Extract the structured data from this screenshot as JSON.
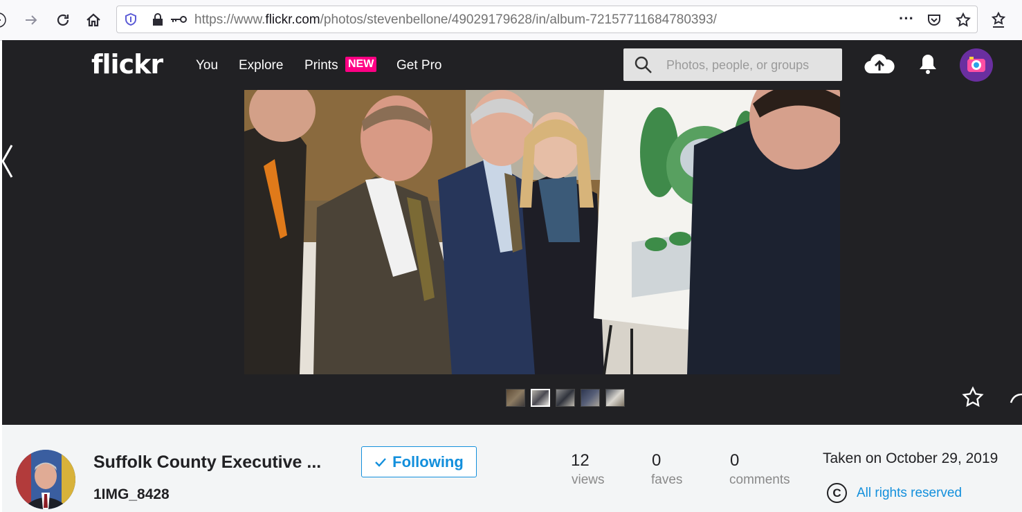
{
  "browser": {
    "url_prefix": "https://www.",
    "url_domain": "flickr.com",
    "url_path": "/photos/stevenbellone/49029179628/in/album-72157711684780393/",
    "icons": [
      "back-arrow-icon",
      "forward-arrow-icon",
      "reload-icon",
      "home-icon",
      "shield-icon",
      "lock-icon",
      "key-icon",
      "more-icon",
      "pocket-icon",
      "star-icon",
      "bookmarks-icon"
    ]
  },
  "header": {
    "logo": "flickr",
    "nav": {
      "you": "You",
      "explore": "Explore",
      "prints": "Prints",
      "prints_badge": "NEW",
      "get_pro": "Get Pro"
    },
    "search_placeholder": "Photos, people, or groups"
  },
  "photo": {
    "thumbnail_count": 5
  },
  "info": {
    "owner_name": "Suffolk County Executive ...",
    "photo_title": "1IMG_8428",
    "follow_label": "Following",
    "views_count": "12",
    "views_label": "views",
    "faves_count": "0",
    "faves_label": "faves",
    "comments_count": "0",
    "comments_label": "comments",
    "taken": "Taken on October 29, 2019",
    "rights_icon": "C",
    "rights": "All rights reserved"
  },
  "colors": {
    "header_bg": "#212124",
    "accent_blue": "#128fdc",
    "new_badge": "#ff0084",
    "info_bg": "#f3f5f6"
  }
}
